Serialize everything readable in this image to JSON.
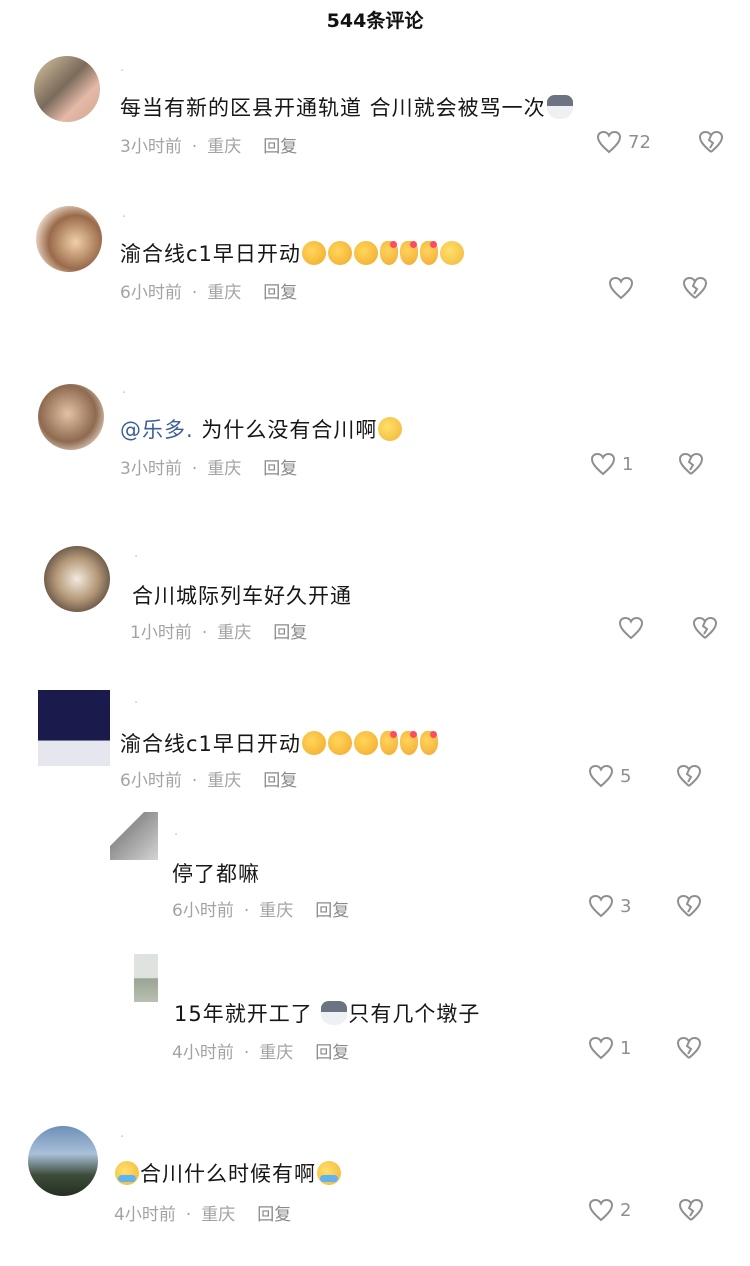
{
  "header": {
    "title": "544条评论"
  },
  "comments": [
    {
      "username": "·",
      "text": "每当有新的区县开通轨道 合川就会被骂一次",
      "time": "3小时前",
      "location": "重庆",
      "reply": "回复",
      "likes": "72"
    },
    {
      "username": "·",
      "text": "渝合线c1早日开动",
      "time": "6小时前",
      "location": "重庆",
      "reply": "回复",
      "likes": ""
    },
    {
      "username": "·",
      "mention": "@乐多.",
      "text": "为什么没有合川啊",
      "time": "3小时前",
      "location": "重庆",
      "reply": "回复",
      "likes": "1"
    },
    {
      "username": "·",
      "text": "合川城际列车好久开通",
      "time": "1小时前",
      "location": "重庆",
      "reply": "回复",
      "likes": ""
    },
    {
      "username": "·",
      "text": "渝合线c1早日开动",
      "time": "6小时前",
      "location": "重庆",
      "reply": "回复",
      "likes": "5"
    },
    {
      "username": "·",
      "text": "停了都嘛",
      "time": "6小时前",
      "location": "重庆",
      "reply": "回复",
      "likes": "3"
    },
    {
      "username": "·",
      "text": "15年就开工了",
      "text2": "只有几个墩子",
      "time": "4小时前",
      "location": "重庆",
      "reply": "回复",
      "likes": "1"
    },
    {
      "username": "·",
      "text": "合川什么时候有啊",
      "time": "4小时前",
      "location": "重庆",
      "reply": "回复",
      "likes": "2"
    }
  ],
  "meta_separator": "·",
  "icons": {
    "like": "heart-outline-icon",
    "dislike": "broken-heart-icon"
  },
  "colors": {
    "mention": "#3d5f96",
    "meta": "#a3a3a3",
    "text": "#161616"
  }
}
